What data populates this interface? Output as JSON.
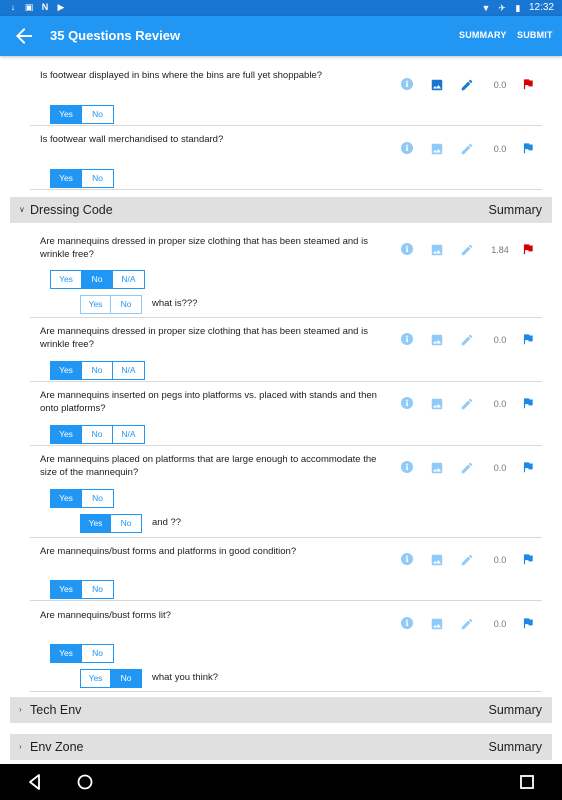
{
  "status_bar": {
    "time": "12:32",
    "left_icons": [
      "download-icon",
      "photo-icon",
      "n-icon",
      "play-store-icon"
    ],
    "right_icons": [
      "wifi-icon",
      "airplane-icon",
      "battery-icon"
    ]
  },
  "app_bar": {
    "title": "35 Questions Review",
    "summary_label": "SUMMARY",
    "submit_label": "SUBMIT"
  },
  "colors": {
    "primary": "#2196f3",
    "status_bar": "#1976d2",
    "flag_red": "#d50000",
    "flag_blue": "#1e88e5",
    "section_bg": "#e0e0e0"
  },
  "questions_top": [
    {
      "text": "Is footwear displayed in bins where the bins are full yet shoppable?",
      "score": "0.0",
      "flag": "red",
      "options": [
        "Yes",
        "No"
      ],
      "selected": "Yes"
    },
    {
      "text": "Is footwear wall merchandised to standard?",
      "score": "0.0",
      "flag": "blue",
      "options": [
        "Yes",
        "No"
      ],
      "selected": "Yes"
    }
  ],
  "sections": {
    "dressing": {
      "title": "Dressing Code",
      "summary": "Summary",
      "expanded": true
    },
    "tech": {
      "title": "Tech Env",
      "summary": "Summary",
      "expanded": false
    },
    "env": {
      "title": "Env Zone",
      "summary": "Summary",
      "expanded": false
    }
  },
  "dressing_questions": [
    {
      "text": "Are mannequins dressed in proper size clothing that has been steamed and is wrinkle free?",
      "score": "1.84",
      "flag": "red",
      "options": [
        "Yes",
        "No",
        "N/A"
      ],
      "selected": "No",
      "followup": {
        "options": [
          "Yes",
          "No"
        ],
        "selected": "",
        "label": "what is???"
      }
    },
    {
      "text": "Are mannequins dressed in proper size clothing that has been steamed and is wrinkle free?",
      "score": "0.0",
      "flag": "blue",
      "options": [
        "Yes",
        "No",
        "N/A"
      ],
      "selected": "Yes"
    },
    {
      "text": "Are mannequins inserted on pegs into platforms vs. placed with stands and then onto platforms?",
      "score": "0.0",
      "flag": "blue",
      "options": [
        "Yes",
        "No",
        "N/A"
      ],
      "selected": "Yes"
    },
    {
      "text": "Are mannequins placed on platforms that are large enough to accommodate the size of the mannequin?",
      "score": "0.0",
      "flag": "blue",
      "options": [
        "Yes",
        "No"
      ],
      "selected": "Yes",
      "followup": {
        "options": [
          "Yes",
          "No"
        ],
        "selected": "Yes",
        "label": "and ??"
      }
    },
    {
      "text": "Are mannequins/bust forms and platforms in good condition?",
      "score": "0.0",
      "flag": "blue",
      "options": [
        "Yes",
        "No"
      ],
      "selected": "Yes"
    },
    {
      "text": "Are mannequins/bust forms lit?",
      "score": "0.0",
      "flag": "blue",
      "options": [
        "Yes",
        "No"
      ],
      "selected": "Yes",
      "followup": {
        "options": [
          "Yes",
          "No"
        ],
        "selected": "No",
        "label": "what you think?"
      }
    }
  ],
  "nav_bar": {
    "buttons": [
      "back-nav-icon",
      "home-nav-icon",
      "recents-nav-icon"
    ]
  }
}
